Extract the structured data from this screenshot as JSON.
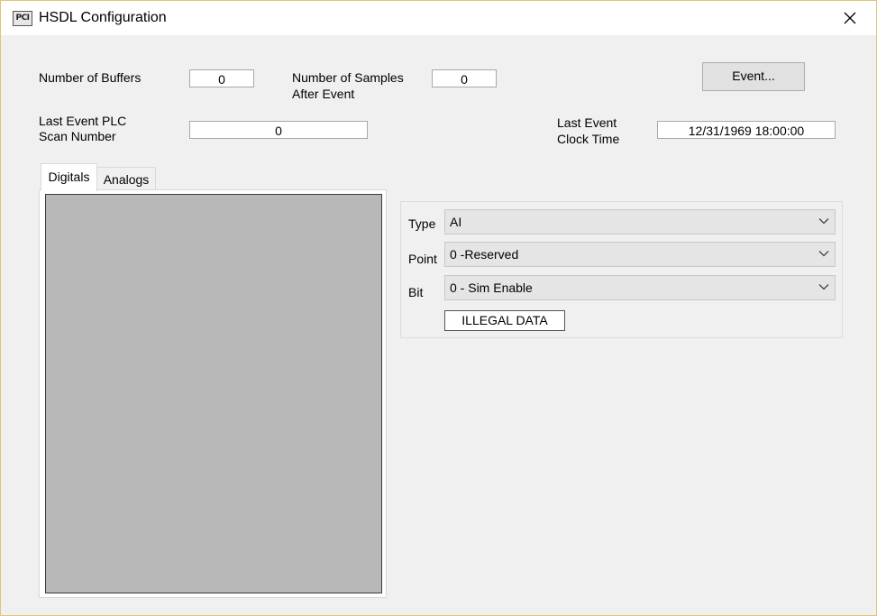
{
  "window": {
    "icon_text": "PCI",
    "title": "HSDL Configuration"
  },
  "fields": {
    "num_buffers_label": "Number of Buffers",
    "num_buffers_value": "0",
    "num_samples_label_line1": "Number of Samples",
    "num_samples_label_line2": "After Event",
    "num_samples_value": "0",
    "event_button": "Event...",
    "last_scan_label_line1": "Last Event PLC",
    "last_scan_label_line2": "Scan Number",
    "last_scan_value": "0",
    "last_clock_label_line1": "Last Event",
    "last_clock_label_line2": "Clock Time",
    "last_clock_value": "12/31/1969 18:00:00"
  },
  "tabs": [
    {
      "label": "Digitals",
      "selected": true
    },
    {
      "label": "Analogs",
      "selected": false
    }
  ],
  "selector": {
    "type_label": "Type",
    "type_value": "AI",
    "point_label": "Point",
    "point_value": "0 -Reserved",
    "bit_label": "Bit",
    "bit_value": "0 - Sim Enable",
    "status": "ILLEGAL DATA"
  },
  "icons": {
    "close": "close-icon",
    "dropdown": "chevron-down-icon"
  }
}
